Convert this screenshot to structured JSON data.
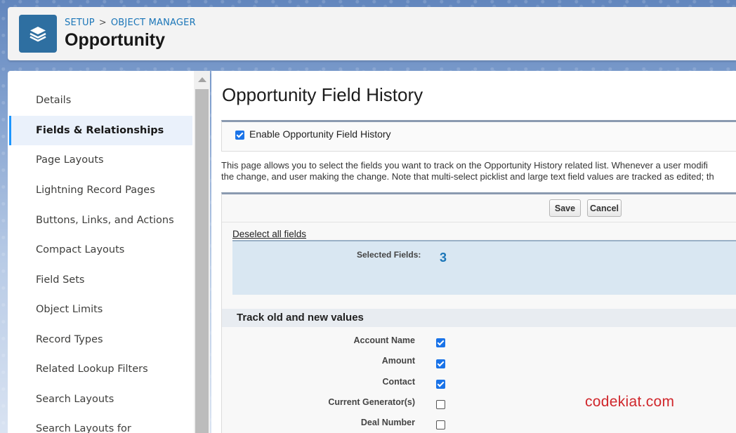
{
  "header": {
    "breadcrumb": [
      "SETUP",
      "OBJECT MANAGER"
    ],
    "breadcrumb_sep": ">",
    "title": "Opportunity",
    "icon": "layers-icon"
  },
  "sidebar": {
    "items": [
      {
        "label": "Details",
        "active": false
      },
      {
        "label": "Fields & Relationships",
        "active": true
      },
      {
        "label": "Page Layouts",
        "active": false
      },
      {
        "label": "Lightning Record Pages",
        "active": false
      },
      {
        "label": "Buttons, Links, and Actions",
        "active": false
      },
      {
        "label": "Compact Layouts",
        "active": false
      },
      {
        "label": "Field Sets",
        "active": false
      },
      {
        "label": "Object Limits",
        "active": false
      },
      {
        "label": "Record Types",
        "active": false
      },
      {
        "label": "Related Lookup Filters",
        "active": false
      },
      {
        "label": "Search Layouts",
        "active": false
      },
      {
        "label": "Search Layouts for",
        "active": false
      }
    ]
  },
  "main": {
    "title": "Opportunity Field History",
    "enable_label": "Enable Opportunity Field History",
    "enable_checked": true,
    "description_lines": [
      "This page allows you to select the fields you want to track on the Opportunity History related list. Whenever a user modifi",
      "the change, and user making the change. Note that multi-select picklist and large text field values are tracked as edited; th"
    ],
    "save_label": "Save",
    "cancel_label": "Cancel",
    "deselect_label": "Deselect all fields",
    "selected_fields_label": "Selected Fields:",
    "selected_fields_count": "3",
    "track_section_title": "Track old and new values",
    "fields": [
      {
        "label": "Account Name",
        "checked": true
      },
      {
        "label": "Amount",
        "checked": true
      },
      {
        "label": "Contact",
        "checked": true
      },
      {
        "label": "Current Generator(s)",
        "checked": false
      },
      {
        "label": "Deal Number",
        "checked": false
      }
    ]
  },
  "watermark": "codekiat.com",
  "colors": {
    "accent": "#1b76b8",
    "checkbox_on": "#1a73e8",
    "watermark": "#d0262b"
  }
}
